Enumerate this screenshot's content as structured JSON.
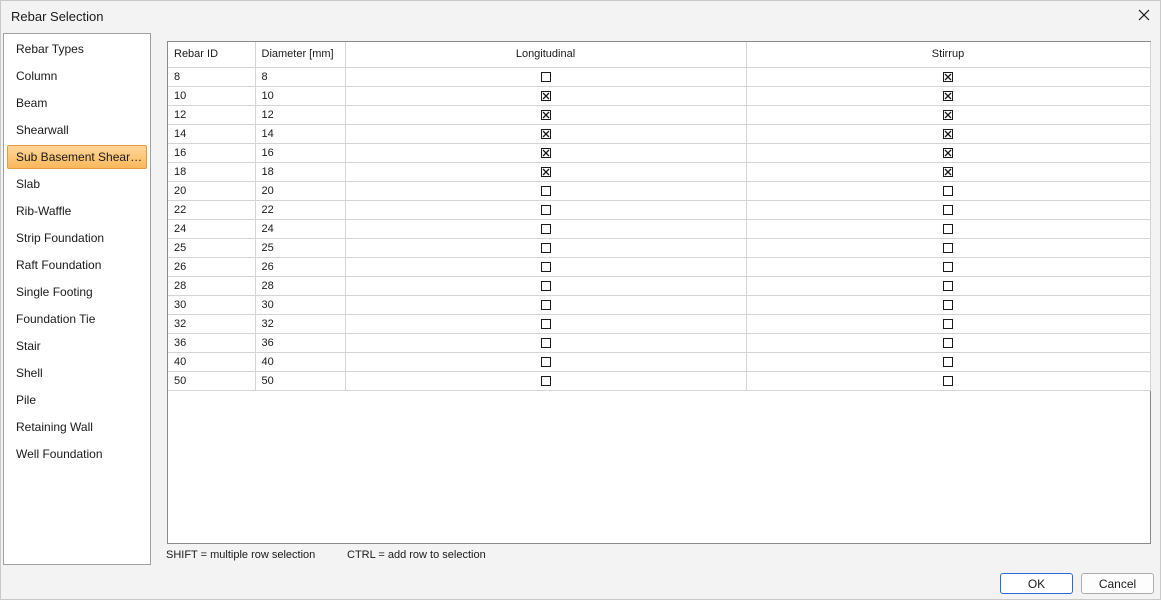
{
  "window": {
    "title": "Rebar Selection"
  },
  "sidebar": {
    "items": [
      {
        "label": "Rebar Types",
        "selected": false
      },
      {
        "label": "Column",
        "selected": false
      },
      {
        "label": "Beam",
        "selected": false
      },
      {
        "label": "Shearwall",
        "selected": false
      },
      {
        "label": "Sub Basement Shearw...",
        "selected": true
      },
      {
        "label": "Slab",
        "selected": false
      },
      {
        "label": "Rib-Waffle",
        "selected": false
      },
      {
        "label": "Strip Foundation",
        "selected": false
      },
      {
        "label": "Raft Foundation",
        "selected": false
      },
      {
        "label": "Single Footing",
        "selected": false
      },
      {
        "label": "Foundation Tie",
        "selected": false
      },
      {
        "label": "Stair",
        "selected": false
      },
      {
        "label": "Shell",
        "selected": false
      },
      {
        "label": "Pile",
        "selected": false
      },
      {
        "label": "Retaining Wall",
        "selected": false
      },
      {
        "label": "Well Foundation",
        "selected": false
      }
    ]
  },
  "grid": {
    "columns": [
      "Rebar ID",
      "Diameter [mm]",
      "Longitudinal",
      "Stirrup"
    ],
    "rows": [
      {
        "id": "8",
        "diameter": "8",
        "longitudinal": false,
        "stirrup": true
      },
      {
        "id": "10",
        "diameter": "10",
        "longitudinal": true,
        "stirrup": true
      },
      {
        "id": "12",
        "diameter": "12",
        "longitudinal": true,
        "stirrup": true
      },
      {
        "id": "14",
        "diameter": "14",
        "longitudinal": true,
        "stirrup": true
      },
      {
        "id": "16",
        "diameter": "16",
        "longitudinal": true,
        "stirrup": true
      },
      {
        "id": "18",
        "diameter": "18",
        "longitudinal": true,
        "stirrup": true
      },
      {
        "id": "20",
        "diameter": "20",
        "longitudinal": false,
        "stirrup": false
      },
      {
        "id": "22",
        "diameter": "22",
        "longitudinal": false,
        "stirrup": false
      },
      {
        "id": "24",
        "diameter": "24",
        "longitudinal": false,
        "stirrup": false
      },
      {
        "id": "25",
        "diameter": "25",
        "longitudinal": false,
        "stirrup": false
      },
      {
        "id": "26",
        "diameter": "26",
        "longitudinal": false,
        "stirrup": false
      },
      {
        "id": "28",
        "diameter": "28",
        "longitudinal": false,
        "stirrup": false
      },
      {
        "id": "30",
        "diameter": "30",
        "longitudinal": false,
        "stirrup": false
      },
      {
        "id": "32",
        "diameter": "32",
        "longitudinal": false,
        "stirrup": false
      },
      {
        "id": "36",
        "diameter": "36",
        "longitudinal": false,
        "stirrup": false
      },
      {
        "id": "40",
        "diameter": "40",
        "longitudinal": false,
        "stirrup": false
      },
      {
        "id": "50",
        "diameter": "50",
        "longitudinal": false,
        "stirrup": false
      }
    ]
  },
  "hints": {
    "shift": "SHIFT = multiple row selection",
    "ctrl": "CTRL = add row to selection"
  },
  "buttons": {
    "ok": "OK",
    "cancel": "Cancel"
  },
  "colors": {
    "selected_item": "#fbb75a",
    "primary_border": "#2a6bd1"
  }
}
